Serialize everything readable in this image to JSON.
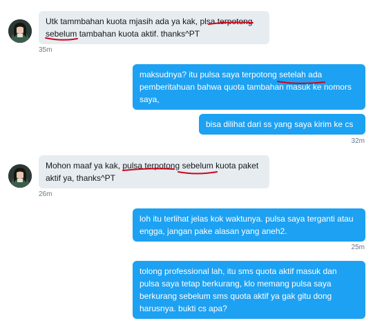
{
  "messages": [
    {
      "direction": "in",
      "lines": [
        "Utk tammbahan kuota mjasih ada ya kak, plsa terpotong",
        "sebelum tambahan kuota aktif. thanks^PT"
      ],
      "time": "35m"
    },
    {
      "direction": "out",
      "lines": [
        "maksudnya? itu pulsa saya terpotong setelah ada",
        "pemberitahuan bahwa quota tambahan masuk ke nomors",
        "saya,"
      ]
    },
    {
      "direction": "out",
      "lines": [
        "bisa dilihat dari ss yang saya kirim ke cs"
      ],
      "time": "32m"
    },
    {
      "direction": "in",
      "lines": [
        "Mohon maaf ya kak, pulsa terpotong sebelum kuota paket",
        "aktif ya, thanks^PT"
      ],
      "time": "26m"
    },
    {
      "direction": "out",
      "lines": [
        "loh itu terlihat jelas kok waktunya. pulsa saya terganti atau",
        "engga, jangan pake alasan yang aneh2."
      ],
      "time": "25m"
    },
    {
      "direction": "out",
      "lines": [
        "tolong professional lah, itu sms quota aktif masuk dan",
        "pulsa saya tetap berkurang, klo memang pulsa saya",
        "berkurang sebelum sms quota aktif ya gak gitu dong",
        "harusnya. bukti cs apa?"
      ]
    }
  ],
  "colors": {
    "incoming_bg": "#e6ecf0",
    "outgoing_bg": "#1da1f2",
    "timestamp": "#657786",
    "annotation_ink": "#d0021b"
  },
  "icons": {
    "avatar": "user-avatar"
  }
}
